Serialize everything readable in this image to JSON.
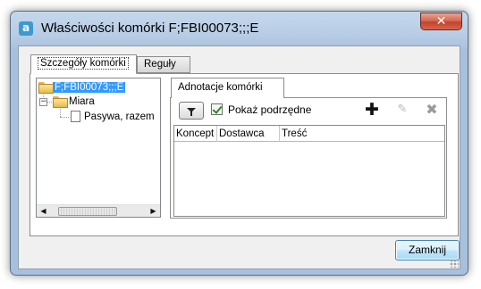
{
  "window": {
    "title": "Właściwości komórki F;FBI00073;;;E",
    "app_icon_letter": "a",
    "close_glyph": "✕"
  },
  "tabs": [
    {
      "label": "Szczegóły komórki",
      "active": true
    },
    {
      "label": "Reguły",
      "active": false
    }
  ],
  "tree": {
    "items": [
      {
        "label": "F;FBI00073;;;E",
        "icon": "folder-open-icon",
        "selected": true
      },
      {
        "label": "Miara",
        "icon": "folder-open-icon",
        "expander": "−"
      },
      {
        "label": "Pasywa, razem",
        "icon": "document-icon"
      }
    ],
    "scroll_left": "◀",
    "scroll_right": "▶"
  },
  "annotations": {
    "tab_label": "Adnotacje komórki",
    "show_children_label": "Pokaż podrzędne",
    "show_children_checked": true,
    "add_glyph": "✚",
    "edit_glyph": "✎",
    "delete_glyph": "✖",
    "columns": [
      "Koncept",
      "Dostawca",
      "Treść"
    ]
  },
  "footer": {
    "close_label": "Zamknij"
  },
  "colors": {
    "selection": "#3399ff",
    "titlebar": "#b8cde5",
    "close_button": "#c2432c"
  }
}
